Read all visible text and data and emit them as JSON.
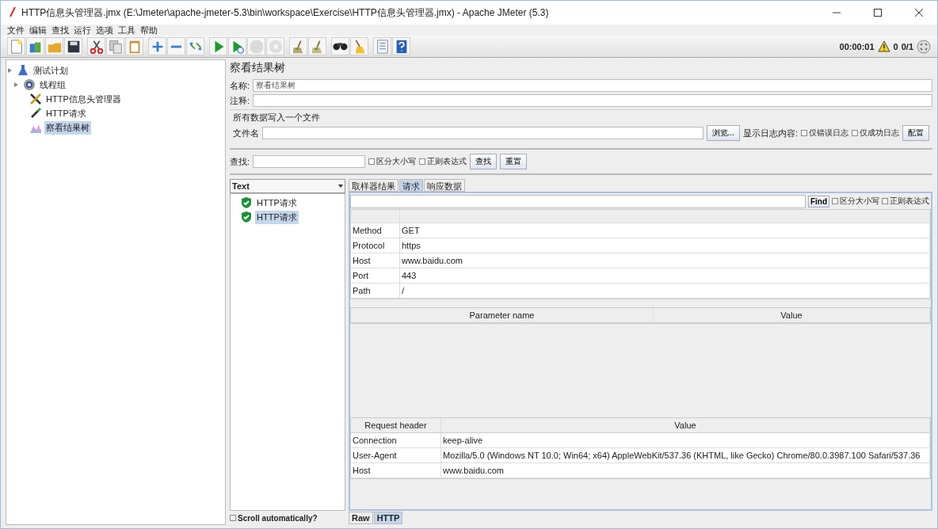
{
  "window": {
    "title": "HTTP信息头管理器.jmx (E:\\Jmeter\\apache-jmeter-5.3\\bin\\workspace\\Exercise\\HTTP信息头管理器.jmx) - Apache JMeter (5.3)"
  },
  "menu": [
    "文件",
    "编辑",
    "查找",
    "运行",
    "选项",
    "工具",
    "帮助"
  ],
  "toolbar": [
    {
      "kind": "new",
      "disabled": false
    },
    {
      "kind": "templates",
      "disabled": false
    },
    {
      "kind": "open",
      "disabled": false
    },
    {
      "kind": "save",
      "disabled": false
    },
    {
      "kind": "cut",
      "disabled": false
    },
    {
      "kind": "copy",
      "disabled": false
    },
    {
      "kind": "paste",
      "disabled": false
    },
    {
      "kind": "expand",
      "disabled": false
    },
    {
      "kind": "collapse",
      "disabled": false
    },
    {
      "kind": "toggle",
      "disabled": false
    },
    {
      "kind": "start",
      "disabled": false
    },
    {
      "kind": "start_no_pause",
      "disabled": false
    },
    {
      "kind": "stop",
      "disabled": true
    },
    {
      "kind": "shutdown",
      "disabled": true
    },
    {
      "kind": "clear",
      "disabled": false
    },
    {
      "kind": "clear_all",
      "disabled": false
    },
    {
      "kind": "search",
      "disabled": false
    },
    {
      "kind": "reset_search",
      "disabled": false
    },
    {
      "kind": "functions",
      "disabled": false
    },
    {
      "kind": "help",
      "disabled": false
    }
  ],
  "status": {
    "elapsed": "00:00:01",
    "errors": "0",
    "threads": "0/1"
  },
  "tree": [
    {
      "label": "测试计划",
      "kind": "plan",
      "selected": false,
      "children": [
        {
          "label": "线程组",
          "kind": "threads",
          "selected": false,
          "children": [
            {
              "label": "HTTP信息头管理器",
              "kind": "config",
              "selected": false
            },
            {
              "label": "HTTP请求",
              "kind": "sampler",
              "selected": false
            },
            {
              "label": "察看结果树",
              "kind": "listener",
              "selected": true
            }
          ]
        }
      ]
    }
  ],
  "panel": {
    "title": "察看结果树",
    "name_label": "名称:",
    "name_value": "察看结果树",
    "comment_label": "注释:",
    "file_section": "所有数据写入一个文件",
    "file_label": "文件名",
    "browse_button": "浏览...",
    "log_label": "显示日志内容:",
    "log_options": [
      {
        "label": "仅错误日志",
        "checked": false
      },
      {
        "label": "仅成功日志",
        "checked": false
      }
    ],
    "config_button": "配置",
    "search_label": "查找:",
    "search_options": [
      {
        "label": "区分大小写",
        "checked": false
      },
      {
        "label": "正则表达式",
        "checked": false
      }
    ],
    "search_button": "查找",
    "reset_button": "重置"
  },
  "results": {
    "renderer": "Text",
    "items": [
      {
        "label": "HTTP请求",
        "selected": false
      },
      {
        "label": "HTTP请求",
        "selected": true
      }
    ],
    "scroll_option": {
      "label": "Scroll automatically?",
      "checked": false
    }
  },
  "tabs": [
    {
      "label": "取样器结果",
      "selected": false
    },
    {
      "label": "请求",
      "selected": true
    },
    {
      "label": "响应数据",
      "selected": false
    }
  ],
  "find": {
    "button": "Find",
    "options": [
      {
        "label": "区分大小写",
        "checked": false
      },
      {
        "label": "正则表达式",
        "checked": false
      }
    ]
  },
  "request_rows": [
    {
      "key": "Method",
      "value": "GET"
    },
    {
      "key": "Protocol",
      "value": "https"
    },
    {
      "key": "Host",
      "value": "www.baidu.com"
    },
    {
      "key": "Port",
      "value": "443"
    },
    {
      "key": "Path",
      "value": "/"
    }
  ],
  "parameters": {
    "columns": [
      "Parameter name",
      "Value"
    ]
  },
  "headers": {
    "columns": [
      "Request header",
      "Value"
    ],
    "rows": [
      [
        "Connection",
        "keep-alive"
      ],
      [
        "User-Agent",
        "Mozilla/5.0 (Windows NT 10.0; Win64; x64) AppleWebKit/537.36 (KHTML, like Gecko) Chrome/80.0.3987.100 Safari/537.36"
      ],
      [
        "Host",
        "www.baidu.com"
      ]
    ]
  },
  "bottom_tabs": [
    {
      "label": "Raw",
      "selected": false
    },
    {
      "label": "HTTP",
      "selected": true
    }
  ]
}
